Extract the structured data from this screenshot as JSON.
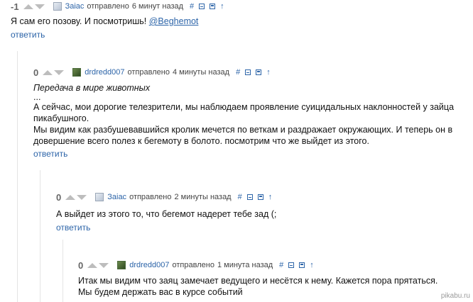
{
  "comments": [
    {
      "rating": "-1",
      "author": "Заiac",
      "sent": "отправлено",
      "time": "6 минут назад",
      "tools": {
        "hash": "#",
        "up": "↑"
      },
      "text": "Я сам его позову. И посмотришь!",
      "mention": "@Beghemot",
      "reply": "ответить"
    },
    {
      "rating": "0",
      "author": "drdredd007",
      "sent": "отправлено",
      "time": "4 минуты назад",
      "tools": {
        "hash": "#",
        "up": "↑"
      },
      "title": "Передача в мире животных",
      "ellipsis": "...",
      "p1": "А сейчас, мои дорогие телезрители, мы наблюдаем проявление суицидальных наклонностей у зайца пикабушного.",
      "p2": "Мы видим как разбушевавшийся кролик мечется по веткам и раздражает окружающих. И теперь он в довершение всего полез к бегемоту в болото. посмотрим что же выйдет из этого.",
      "reply": "ответить"
    },
    {
      "rating": "0",
      "author": "Заiac",
      "sent": "отправлено",
      "time": "2 минуты назад",
      "tools": {
        "hash": "#",
        "up": "↑"
      },
      "text": "А выйдет из этого то, что бегемот надерет тебе зад (;",
      "reply": "ответить"
    },
    {
      "rating": "0",
      "author": "drdredd007",
      "sent": "отправлено",
      "time": "1 минута назад",
      "tools": {
        "hash": "#",
        "up": "↑"
      },
      "line1": "Итак мы видим что заяц замечает ведущего и несётся к нему. Кажется пора прятаться.",
      "line2": "Мы будем держать вас в курсе событий"
    }
  ],
  "watermark": "pikabu.ru"
}
